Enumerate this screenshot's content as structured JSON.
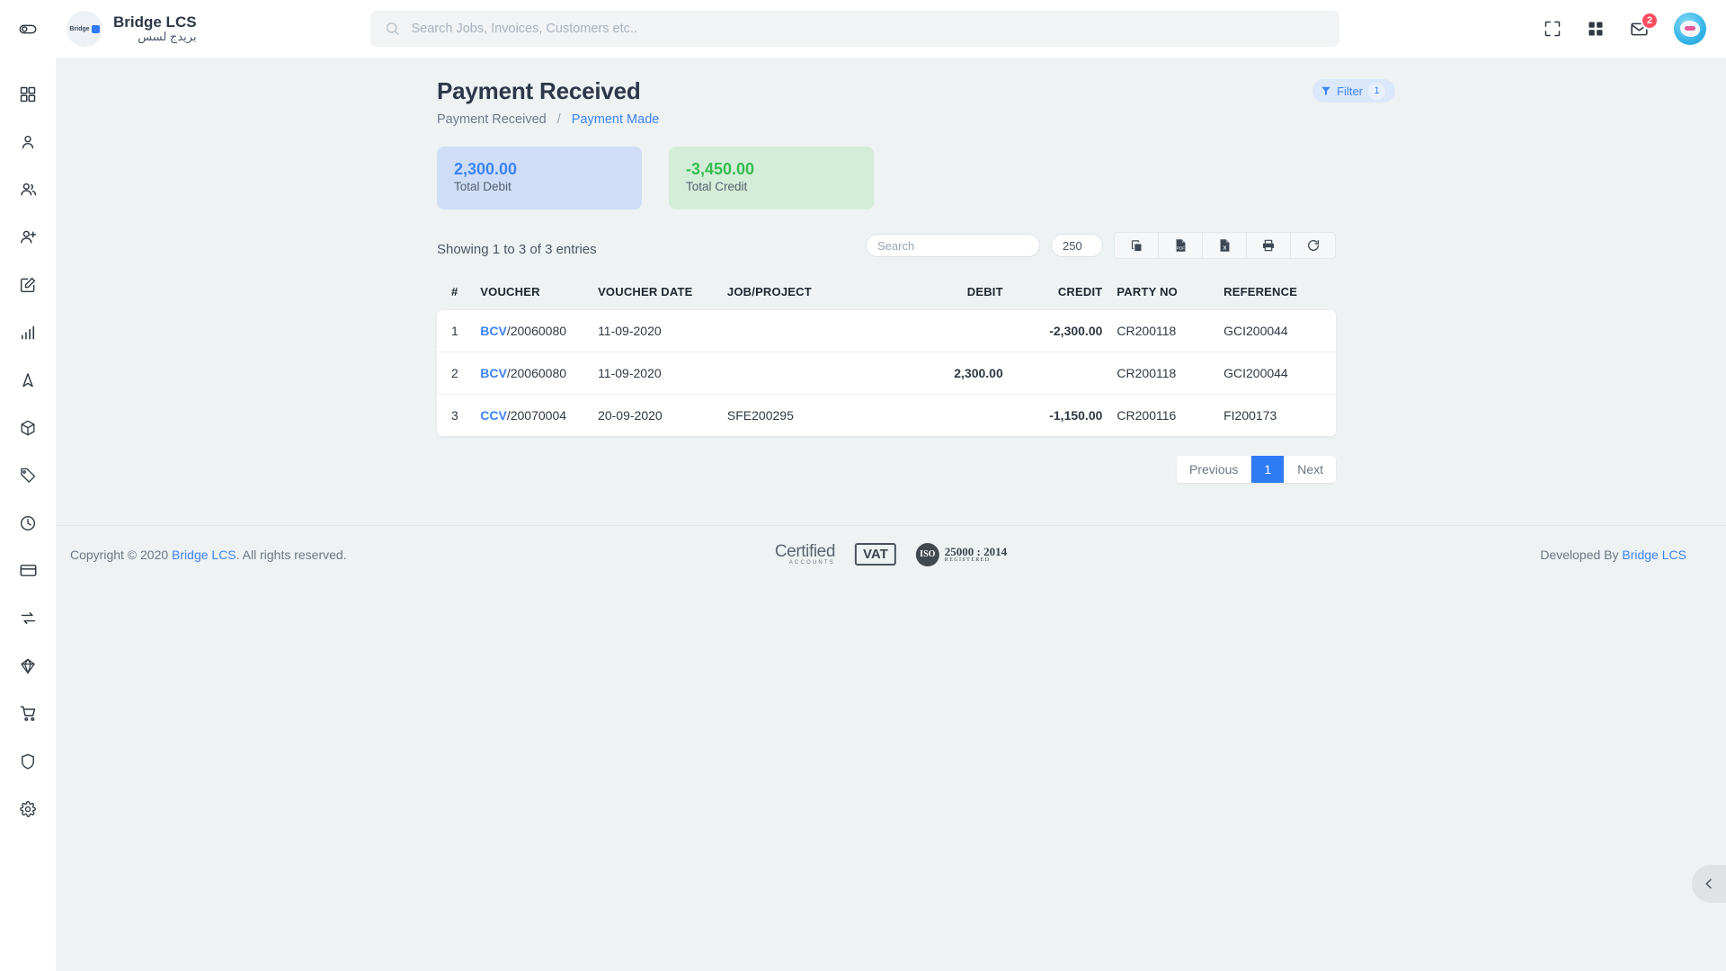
{
  "topbar": {
    "toggle_icon": "sidebar-toggle-icon",
    "brand_title": "Bridge LCS",
    "brand_title_ar": "بريدج لسس",
    "logo_text": "Bridge",
    "search_placeholder": "Search Jobs, Invoices, Customers etc..",
    "search_value": "",
    "search_icon": "search-icon",
    "fullscreen_icon": "fullscreen-icon",
    "apps_icon": "apps-grid-icon",
    "mail_icon": "envelope-icon",
    "mail_badge": "2",
    "avatar_icon": "user-avatar"
  },
  "sidebar": {
    "items": [
      {
        "icon": "dashboard-grid-icon",
        "name": "dashboard"
      },
      {
        "icon": "user-icon",
        "name": "profile"
      },
      {
        "icon": "users-icon",
        "name": "customers"
      },
      {
        "icon": "user-plus-icon",
        "name": "add-user"
      },
      {
        "icon": "edit-square-icon",
        "name": "quotations"
      },
      {
        "icon": "bar-chart-icon",
        "name": "reports"
      },
      {
        "icon": "navigation-arrow-icon",
        "name": "tracking"
      },
      {
        "icon": "box-icon",
        "name": "packages"
      },
      {
        "icon": "tag-icon",
        "name": "pricing"
      },
      {
        "icon": "clock-icon",
        "name": "history"
      },
      {
        "icon": "credit-card-icon",
        "name": "payments"
      },
      {
        "icon": "repeat-icon",
        "name": "transfers"
      },
      {
        "icon": "gem-icon",
        "name": "assets"
      },
      {
        "icon": "shopping-cart-icon",
        "name": "purchases"
      },
      {
        "icon": "shield-icon",
        "name": "security"
      },
      {
        "icon": "gear-icon",
        "name": "settings"
      }
    ]
  },
  "page": {
    "title": "Payment Received",
    "breadcrumb_current": "Payment Received",
    "breadcrumb_sep": "/",
    "breadcrumb_link": "Payment Made",
    "filter_label": "Filter",
    "filter_count": "1",
    "filter_icon": "funnel-icon"
  },
  "cards": [
    {
      "value": "2,300.00",
      "label": "Total Debit",
      "color": "#3c83f6"
    },
    {
      "value": "-3,450.00",
      "label": "Total Credit",
      "color": "#34bd4e"
    }
  ],
  "toolbar": {
    "showing": "Showing 1 to 3 of 3 entries",
    "search_placeholder": "Search",
    "search_value": "",
    "page_length": "250",
    "buttons": [
      {
        "icon": "copy-icon",
        "name": "copy-button"
      },
      {
        "icon": "pdf-file-icon",
        "name": "pdf-button"
      },
      {
        "icon": "excel-file-icon",
        "name": "excel-button"
      },
      {
        "icon": "printer-icon",
        "name": "print-button"
      },
      {
        "icon": "refresh-icon",
        "name": "refresh-button"
      }
    ]
  },
  "table": {
    "columns": [
      "#",
      "VOUCHER",
      "VOUCHER DATE",
      "JOB/PROJECT",
      "DEBIT",
      "CREDIT",
      "PARTY NO",
      "REFERENCE"
    ],
    "rows": [
      {
        "idx": "1",
        "voucher_code": "BCV",
        "voucher_rest": "/20060080",
        "voucher_date": "11-09-2020",
        "job": "",
        "debit": "",
        "credit": "-2,300.00",
        "party_no": "CR200118",
        "reference": "GCI200044"
      },
      {
        "idx": "2",
        "voucher_code": "BCV",
        "voucher_rest": "/20060080",
        "voucher_date": "11-09-2020",
        "job": "",
        "debit": "2,300.00",
        "credit": "",
        "party_no": "CR200118",
        "reference": "GCI200044"
      },
      {
        "idx": "3",
        "voucher_code": "CCV",
        "voucher_rest": "/20070004",
        "voucher_date": "20-09-2020",
        "job": "SFE200295",
        "debit": "",
        "credit": "-1,150.00",
        "party_no": "CR200116",
        "reference": "FI200173"
      }
    ]
  },
  "pagination": {
    "previous": "Previous",
    "current": "1",
    "next": "Next"
  },
  "footer": {
    "copyright_prefix": "Copyright © 2020",
    "copyright_link": "Bridge LCS",
    "copyright_suffix": ". All rights reserved.",
    "certified_main": "Certified",
    "certified_sub": "ACCOUNTS",
    "vat": "VAT",
    "iso_seal": "ISO",
    "iso_number": "25000 : 2014",
    "iso_registered": "REGISTERED",
    "developed_prefix": "Developed By",
    "developed_link": "Bridge LCS"
  },
  "collapse_tab": {
    "icon": "chevron-left-icon"
  }
}
